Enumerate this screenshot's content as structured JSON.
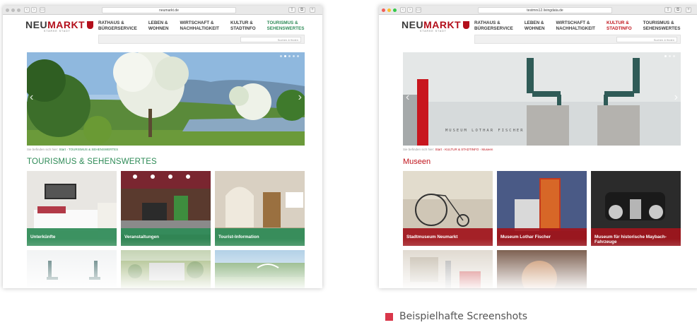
{
  "left": {
    "url": "neumarkt.de",
    "logo": {
      "pre": "NEU",
      "main": "MARKT",
      "sub": "STARKE STADT"
    },
    "nav": [
      "RATHAUS &\nBÜRGERSERVICE",
      "LEBEN &\nWOHNEN",
      "WIRTSCHAFT &\nNACHHALTIGKEIT",
      "KULTUR &\nSTADTINFO",
      "TOURISMUS &\nSEHENSWERTES"
    ],
    "search_placeholder": "Suchen & finden",
    "breadcrumb": {
      "prefix": "Sie befinden sich hier:",
      "items": [
        "Start",
        "TOURISMUS & SEHENSWERTES"
      ]
    },
    "title": "TOURISMUS & SEHENSWERTES",
    "tiles": [
      "Unterkünfte",
      "Veranstaltungen",
      "Tourist-Information",
      "",
      "",
      ""
    ]
  },
  "right": {
    "url": "testmrs12.livingdata.de",
    "logo": {
      "pre": "NEU",
      "main": "MARKT",
      "sub": "STARKE STADT"
    },
    "nav": [
      "RATHAUS &\nBÜRGERSERVICE",
      "LEBEN &\nWOHNEN",
      "WIRTSCHAFT &\nNACHHALTIGKEIT",
      "KULTUR &\nSTADTINFO",
      "TOURISMUS &\nSEHENSWERTES"
    ],
    "search_placeholder": "Suchen & finden",
    "hero_text": "MUSEUM LOTHAR FISCHER",
    "breadcrumb": {
      "prefix": "Sie befinden sich hier:",
      "items": [
        "Start",
        "KULTUR & STADTINFO",
        "Museen"
      ]
    },
    "title": "Museen",
    "tiles": [
      "Stadtmuseum Neumarkt",
      "Museum Lothar Fischer",
      "Museum für historische Maybach-Fahrzeuge",
      "",
      ""
    ]
  },
  "caption": "Beispielhafte Screenshots",
  "colors": {
    "green": "#2e8b57",
    "red": "#c0141c",
    "caption_square": "#d9374a"
  }
}
